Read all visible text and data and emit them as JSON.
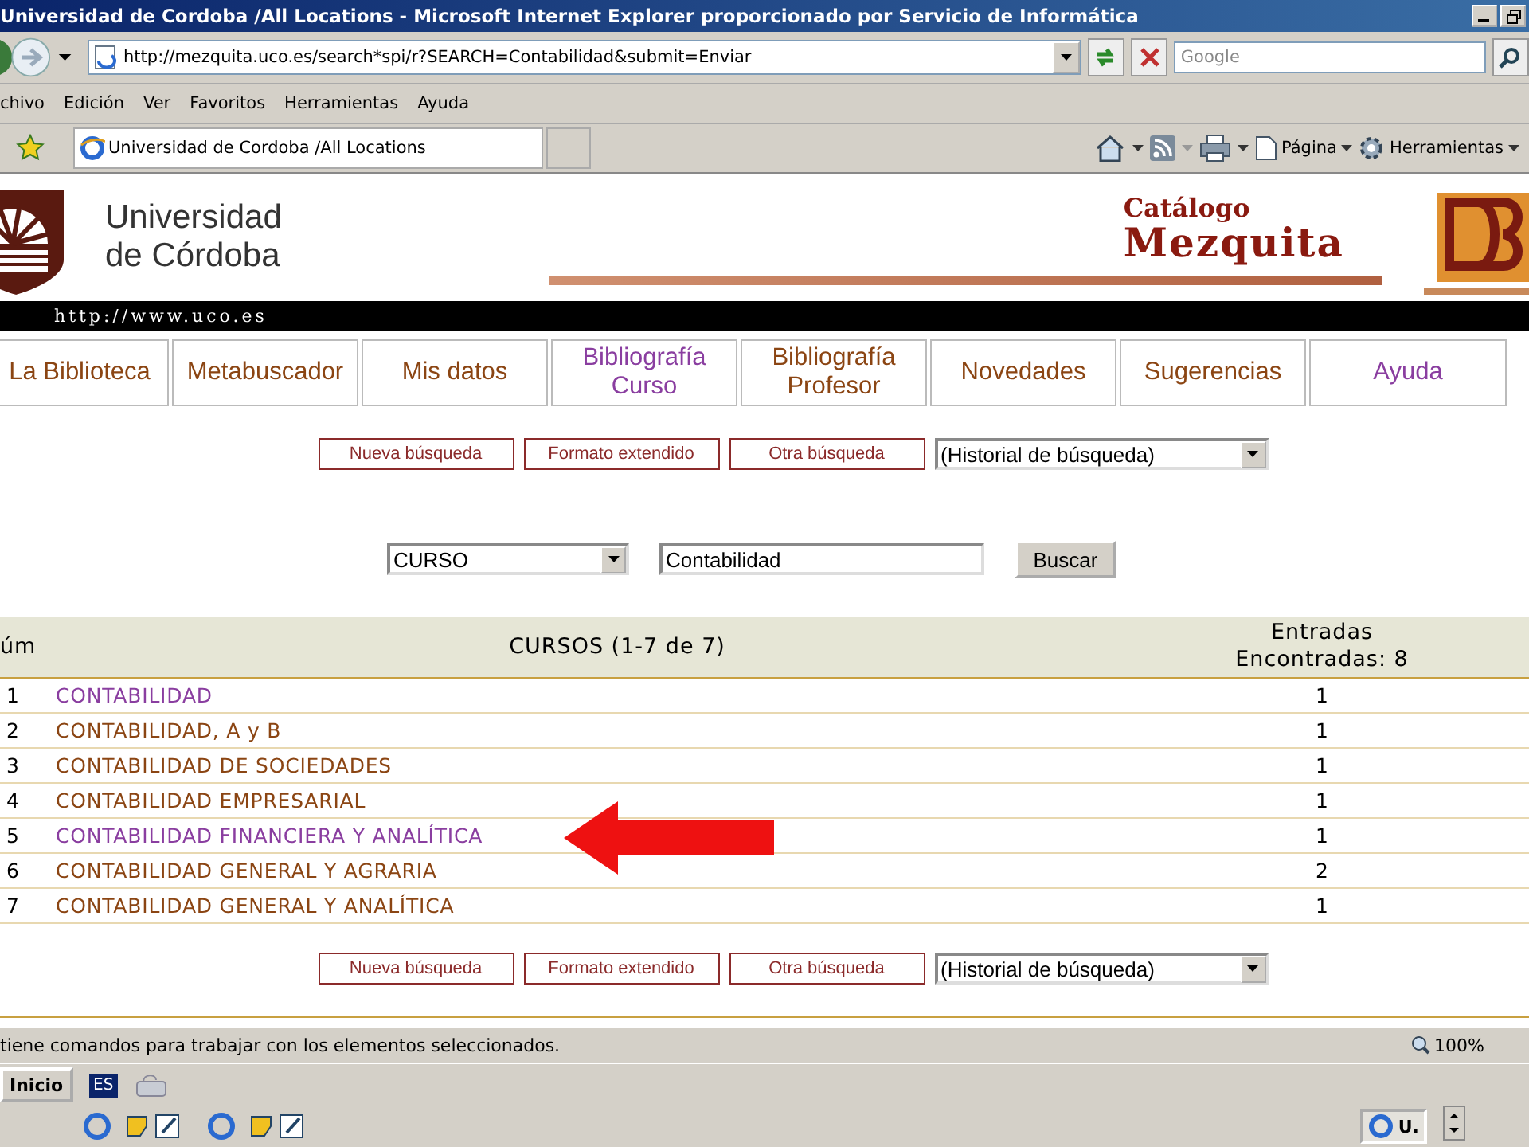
{
  "window": {
    "title": "Universidad de Cordoba /All Locations - Microsoft Internet Explorer proporcionado por Servicio de Informática"
  },
  "address_bar": {
    "url": "http://mezquita.uco.es/search*spi/r?SEARCH=Contabilidad&submit=Enviar",
    "search_placeholder": "Google"
  },
  "menu": [
    "chivo",
    "Edición",
    "Ver",
    "Favoritos",
    "Herramientas",
    "Ayuda"
  ],
  "tab": {
    "label": "Universidad de Cordoba /All Locations"
  },
  "commands": [
    "Página",
    "Herramientas"
  ],
  "header": {
    "university": [
      "Universidad",
      "de Córdoba"
    ],
    "url": "http://www.uco.es",
    "catalog": [
      "Catálogo",
      "Mezquita"
    ]
  },
  "nav": [
    {
      "label": "La Biblioteca",
      "visited": false
    },
    {
      "label": "Metabuscador",
      "visited": false
    },
    {
      "label": "Mis datos",
      "visited": false
    },
    {
      "label": "Bibliografía Curso",
      "visited": true
    },
    {
      "label": "Bibliografía Profesor",
      "visited": false
    },
    {
      "label": "Novedades",
      "visited": false
    },
    {
      "label": "Sugerencias",
      "visited": false
    },
    {
      "label": "Ayuda",
      "visited": true
    }
  ],
  "action_buttons": [
    "Nueva búsqueda",
    "Formato extendido",
    "Otra búsqueda"
  ],
  "history_select": "(Historial de búsqueda)",
  "search": {
    "index": "CURSO",
    "value": "Contabilidad",
    "button": "Buscar"
  },
  "table": {
    "columns": [
      "úm",
      "CURSOS (1-7 de 7)",
      "Entradas Encontradas: 8"
    ],
    "rows": [
      {
        "num": "1",
        "title": "CONTABILIDAD",
        "entries": "1",
        "visited": true
      },
      {
        "num": "2",
        "title": "CONTABILIDAD, A y B",
        "entries": "1",
        "visited": false
      },
      {
        "num": "3",
        "title": "CONTABILIDAD DE SOCIEDADES",
        "entries": "1",
        "visited": false
      },
      {
        "num": "4",
        "title": "CONTABILIDAD EMPRESARIAL",
        "entries": "1",
        "visited": false
      },
      {
        "num": "5",
        "title": "CONTABILIDAD FINANCIERA Y ANALÍTICA",
        "entries": "1",
        "visited": true
      },
      {
        "num": "6",
        "title": "CONTABILIDAD GENERAL Y AGRARIA",
        "entries": "2",
        "visited": false
      },
      {
        "num": "7",
        "title": "CONTABILIDAD GENERAL Y ANALÍTICA",
        "entries": "1",
        "visited": false
      }
    ]
  },
  "bottom_buttons": [
    "Nueva búsqueda",
    "Formato extendido",
    "Otra búsqueda"
  ],
  "bottom_history_select": "(Historial de búsqueda)",
  "status_bar": {
    "text": "tiene comandos para trabajar con los elementos seleccionados.",
    "zoom": "100%"
  },
  "taskbar": {
    "start": "Inicio",
    "language": "ES",
    "task": "U."
  }
}
